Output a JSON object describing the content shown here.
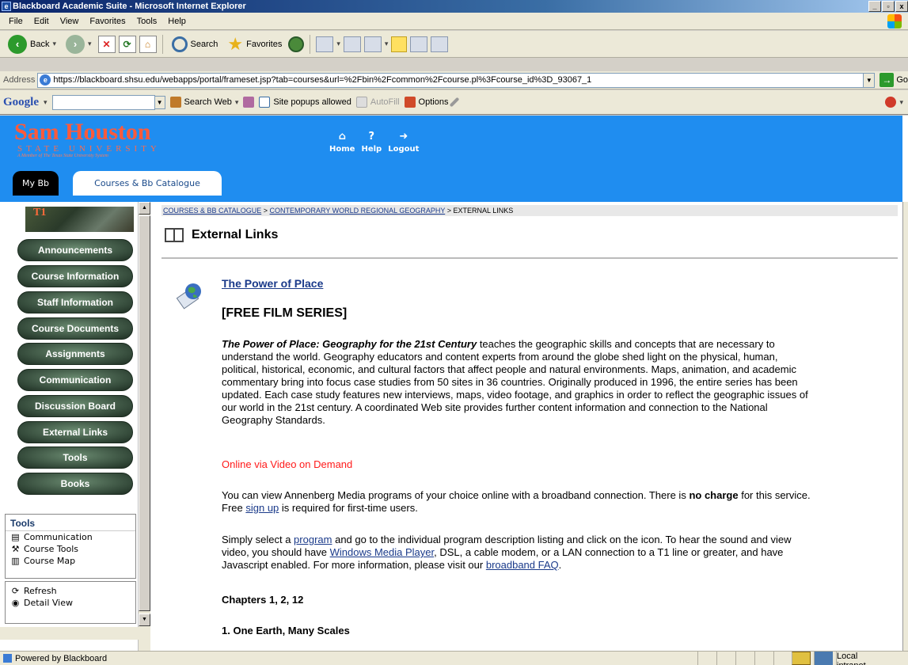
{
  "window": {
    "title": "Blackboard Academic Suite - Microsoft Internet Explorer"
  },
  "menubar": {
    "items": [
      "File",
      "Edit",
      "View",
      "Favorites",
      "Tools",
      "Help"
    ]
  },
  "toolbar": {
    "back_label": "Back",
    "search_label": "Search",
    "favorites_label": "Favorites"
  },
  "address": {
    "label": "Address",
    "url": "https://blackboard.shsu.edu/webapps/portal/frameset.jsp?tab=courses&url=%2Fbin%2Fcommon%2Fcourse.pl%3Fcourse_id%3D_93067_1",
    "go_label": "Go"
  },
  "googlebar": {
    "logo": "Google",
    "search_web": "Search Web",
    "popups": "Site popups allowed",
    "autofill": "AutoFill",
    "options": "Options"
  },
  "header": {
    "logo_main": "Sam Houston",
    "logo_sub": "STATE UNIVERSITY",
    "logo_tagline": "A Member of The Texas State University System",
    "nav": [
      "Home",
      "Help",
      "Logout"
    ],
    "tabs": [
      "My Bb",
      "Courses & Bb Catalogue"
    ]
  },
  "sidebar": {
    "photo_text": "T1",
    "buttons": [
      "Announcements",
      "Course Information",
      "Staff Information",
      "Course Documents",
      "Assignments",
      "Communication",
      "Discussion Board",
      "External Links",
      "Tools",
      "Books"
    ],
    "tools_heading": "Tools",
    "tools_items": [
      "Communication",
      "Course Tools",
      "Course Map"
    ],
    "refresh_items": [
      "Refresh",
      "Detail View"
    ]
  },
  "breadcrumb": {
    "crumbs": [
      "COURSES & BB CATALOGUE",
      "CONTEMPORARY WORLD REGIONAL GEOGRAPHY"
    ],
    "current": "EXTERNAL LINKS",
    "separator": ">"
  },
  "content": {
    "page_title": "External Links",
    "item_title": "The Power of Place",
    "item_subtitle": "[FREE FILM SERIES]",
    "intro_bold": "The Power of Place: Geography for the 21st Century",
    "intro_rest": "teaches the geographic skills and concepts that are necessary to understand the world. Geography educators and content experts from around the globe shed light on the physical, human, political, historical, economic, and cultural factors that affect people and natural environments. Maps, animation, and academic commentary bring into focus case studies from 50 sites in 36 countries. Originally produced in 1996, the entire series has been updated. Each case study features new interviews, maps, video footage, and graphics in order to reflect the geographic issues of our world in the 21st century. A coordinated Web site provides further content information and connection to the National Geography Standards.",
    "online_label": "Online via Video on Demand",
    "view_text_1": "You can view Annenberg Media programs of your choice online with a broadband connection.  There is",
    "view_bold": "no charge",
    "view_text_2": "for this service. Free",
    "signup_link": "sign up",
    "view_text_3": "is required for first-time users.",
    "select_text_1": "Simply select a",
    "program_link": "program",
    "select_text_2": "and go to the individual program description listing and click on the icon. To hear the sound and view video, you should have",
    "wmp_link": "Windows Media Player",
    "select_text_3": ", DSL, a cable modem, or a LAN connection to a T1 line or greater, and have Javascript enabled. For more information, please visit our",
    "faq_link": "broadband FAQ",
    "select_text_4": ".",
    "chapters": "Chapters 1, 2, 12",
    "chapter_item": "1. One Earth, Many Scales"
  },
  "statusbar": {
    "text": "Powered by Blackboard",
    "zone": "Local intranet"
  }
}
